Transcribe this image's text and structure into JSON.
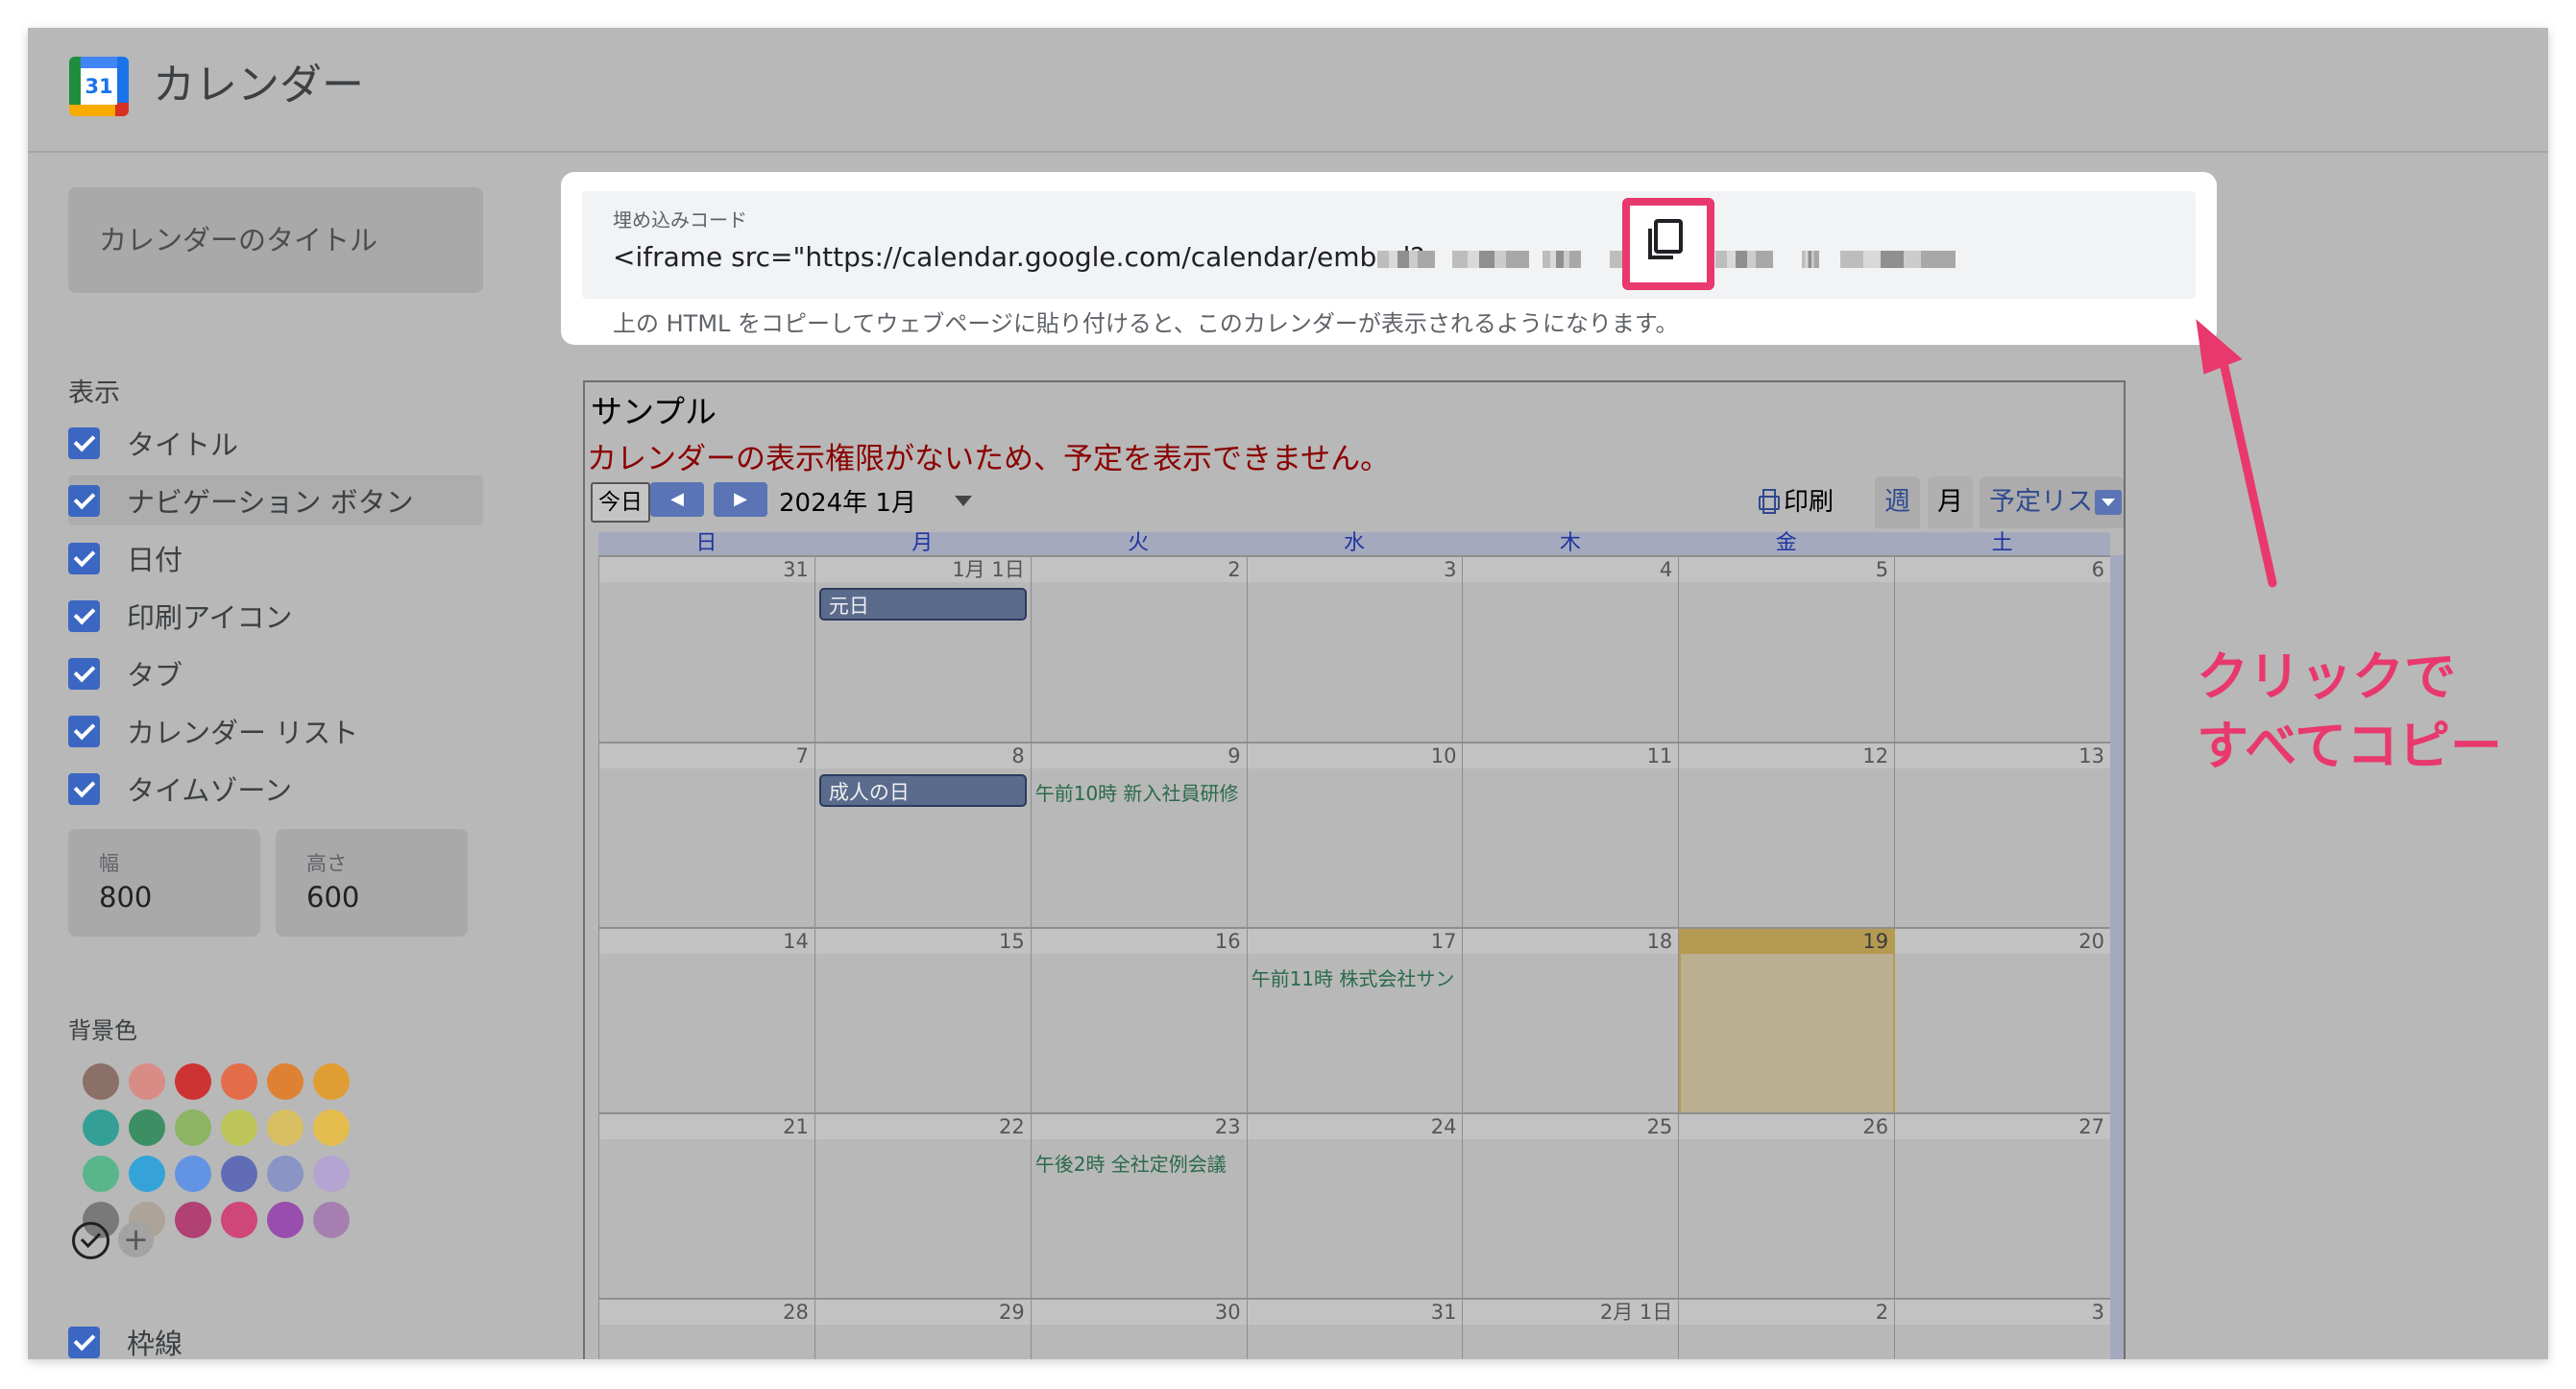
{
  "header": {
    "app_title": "カレンダー",
    "logo_number": "31"
  },
  "sidebar": {
    "title_field_placeholder": "カレンダーのタイトル",
    "display_label": "表示",
    "options": [
      {
        "label": "タイトル",
        "checked": true
      },
      {
        "label": "ナビゲーション ボタン",
        "checked": true
      },
      {
        "label": "日付",
        "checked": true
      },
      {
        "label": "印刷アイコン",
        "checked": true
      },
      {
        "label": "タブ",
        "checked": true
      },
      {
        "label": "カレンダー リスト",
        "checked": true
      },
      {
        "label": "タイムゾーン",
        "checked": true
      }
    ],
    "width": {
      "label": "幅",
      "value": "800"
    },
    "height": {
      "label": "高さ",
      "value": "600"
    },
    "bg_color_label": "背景色",
    "swatches": [
      [
        "#795548",
        "#e67c73",
        "#d50000",
        "#f4511e",
        "#ef6c00",
        "#f09300"
      ],
      [
        "#009688",
        "#0b8043",
        "#7cb342",
        "#c0ca33",
        "#e4c441",
        "#f6bf26"
      ],
      [
        "#33b679",
        "#039be5",
        "#4285f4",
        "#3f51b5",
        "#7986cb",
        "#b39ddb"
      ],
      [
        "#616161",
        "#a79b8e",
        "#ad1457",
        "#d81b60",
        "#8e24aa",
        "#9e69af"
      ]
    ],
    "border": {
      "label": "枠線",
      "checked": true
    }
  },
  "embed": {
    "label": "埋め込みコード",
    "code": "<iframe src=\"https://calendar.google.com/calendar/embed?",
    "help": "上の HTML をコピーしてウェブページに貼り付けると、このカレンダーが表示されるようになります。"
  },
  "calendar": {
    "title": "サンプル",
    "error": "カレンダーの表示権限がないため、予定を表示できません。",
    "today_button": "今日",
    "current_month": "2024年 1月",
    "print_label": "印刷",
    "tabs": [
      "週",
      "月",
      "予定リスト"
    ],
    "weekdays": [
      "日",
      "月",
      "火",
      "水",
      "木",
      "金",
      "土"
    ],
    "weeks": [
      [
        "31",
        "1月 1日",
        "2",
        "3",
        "4",
        "5",
        "6"
      ],
      [
        "7",
        "8",
        "9",
        "10",
        "11",
        "12",
        "13"
      ],
      [
        "14",
        "15",
        "16",
        "17",
        "18",
        "19",
        "20"
      ],
      [
        "21",
        "22",
        "23",
        "24",
        "25",
        "26",
        "27"
      ],
      [
        "28",
        "29",
        "30",
        "31",
        "2月 1日",
        "2",
        "3"
      ]
    ],
    "events": {
      "new_year": "元日",
      "coming_of_age": "成人の日",
      "training": "午前10時 新入社員研修",
      "company": "午前11時 株式会社サン",
      "meeting": "午後2時 全社定例会議"
    }
  },
  "annotation": {
    "line1": "クリックで",
    "line2": "すべてコピー",
    "color": "#e8386d"
  },
  "icons": [
    "copy-icon",
    "calendar-logo-icon",
    "printer-icon",
    "prev-icon",
    "next-icon",
    "dropdown-icon",
    "arrow-icon"
  ]
}
